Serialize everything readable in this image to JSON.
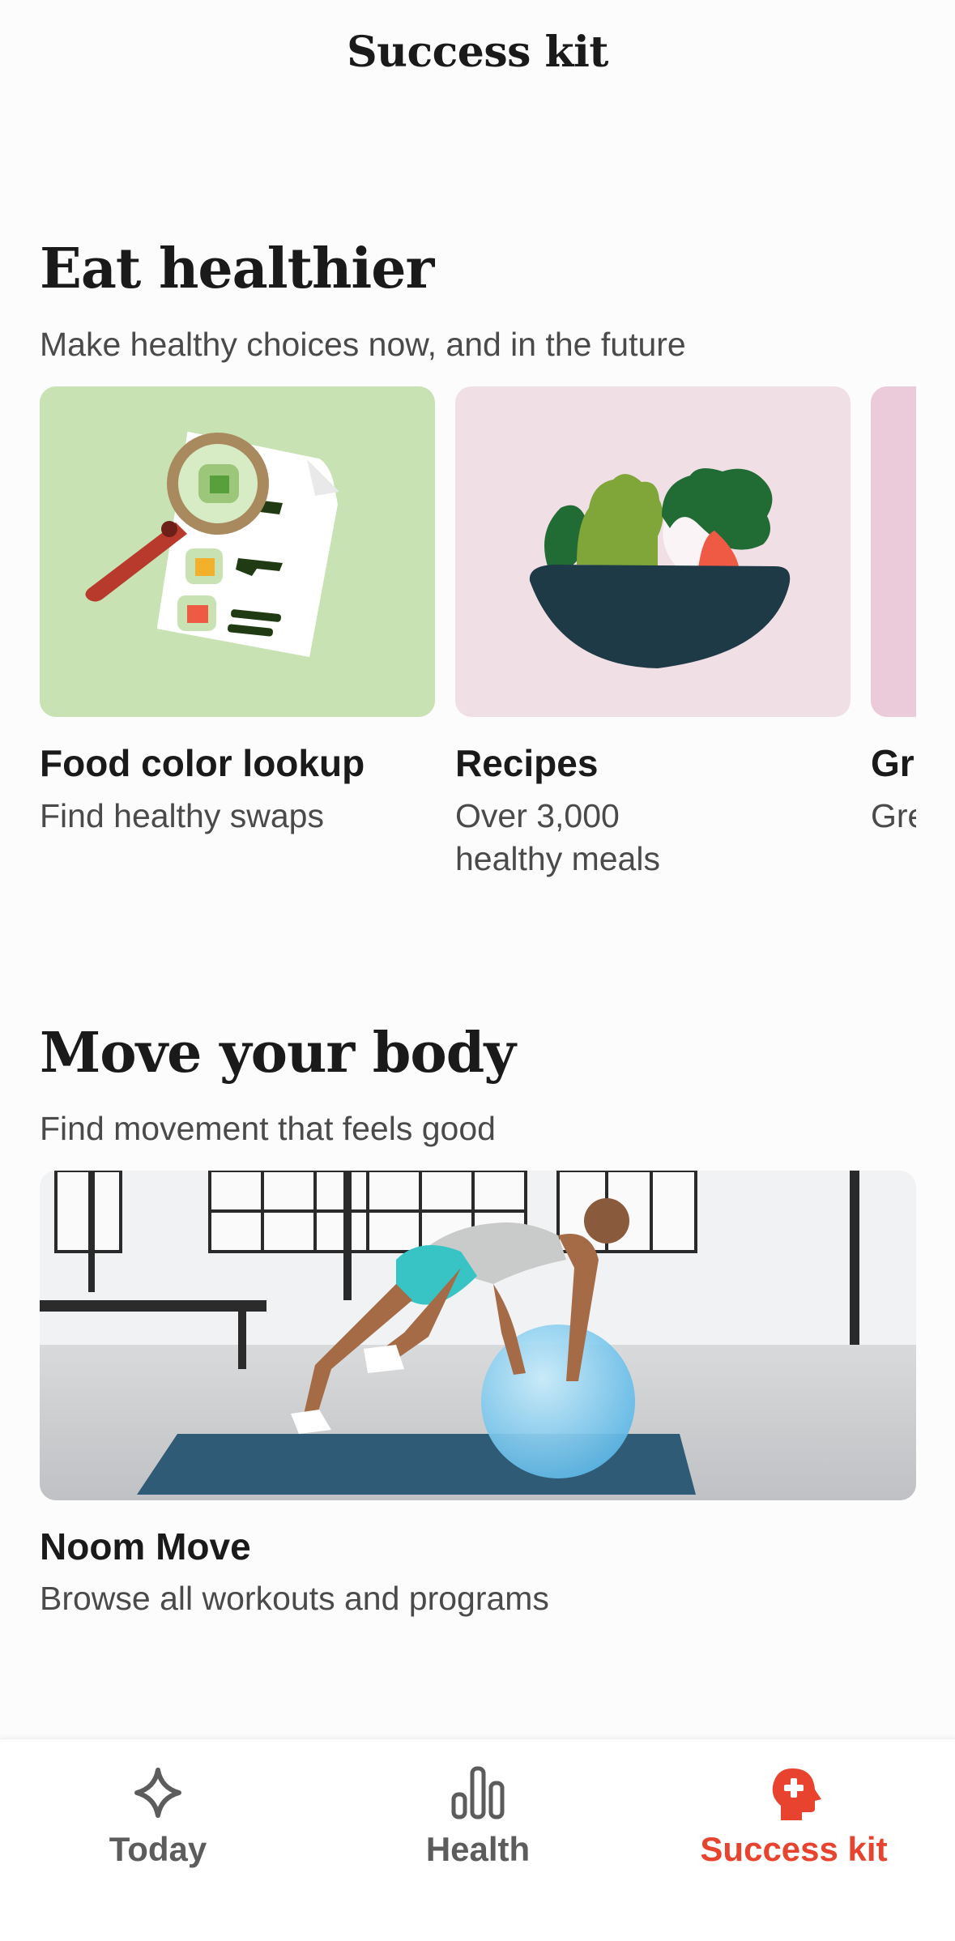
{
  "header": {
    "title": "Success kit"
  },
  "sections": {
    "eat": {
      "title": "Eat healthier",
      "subtitle": "Make healthy choices now, and in the future",
      "cards": [
        {
          "title": "Food color lookup",
          "subtitle": "Find healthy swaps",
          "icon": "magnifier-menu-icon",
          "bg": "#c8e2b3"
        },
        {
          "title": "Recipes",
          "subtitle": "Over 3,000 healthy meals",
          "icon": "salad-bowl-icon",
          "bg": "#f1dfe6"
        },
        {
          "title": "Gr",
          "subtitle": "Gre",
          "bg": "#ebcbd9"
        }
      ]
    },
    "move": {
      "title": "Move your body",
      "subtitle": "Find movement that feels good",
      "card": {
        "title": "Noom Move",
        "subtitle": "Browse all workouts and programs",
        "image": "workout-photo"
      }
    }
  },
  "bottom_nav": {
    "items": [
      {
        "label": "Today",
        "icon": "sparkle-icon",
        "active": false
      },
      {
        "label": "Health",
        "icon": "bar-chart-icon",
        "active": false
      },
      {
        "label": "Success kit",
        "icon": "head-plus-icon",
        "active": true
      }
    ],
    "active_color": "#e8432f",
    "inactive_color": "#5c5c5c"
  }
}
